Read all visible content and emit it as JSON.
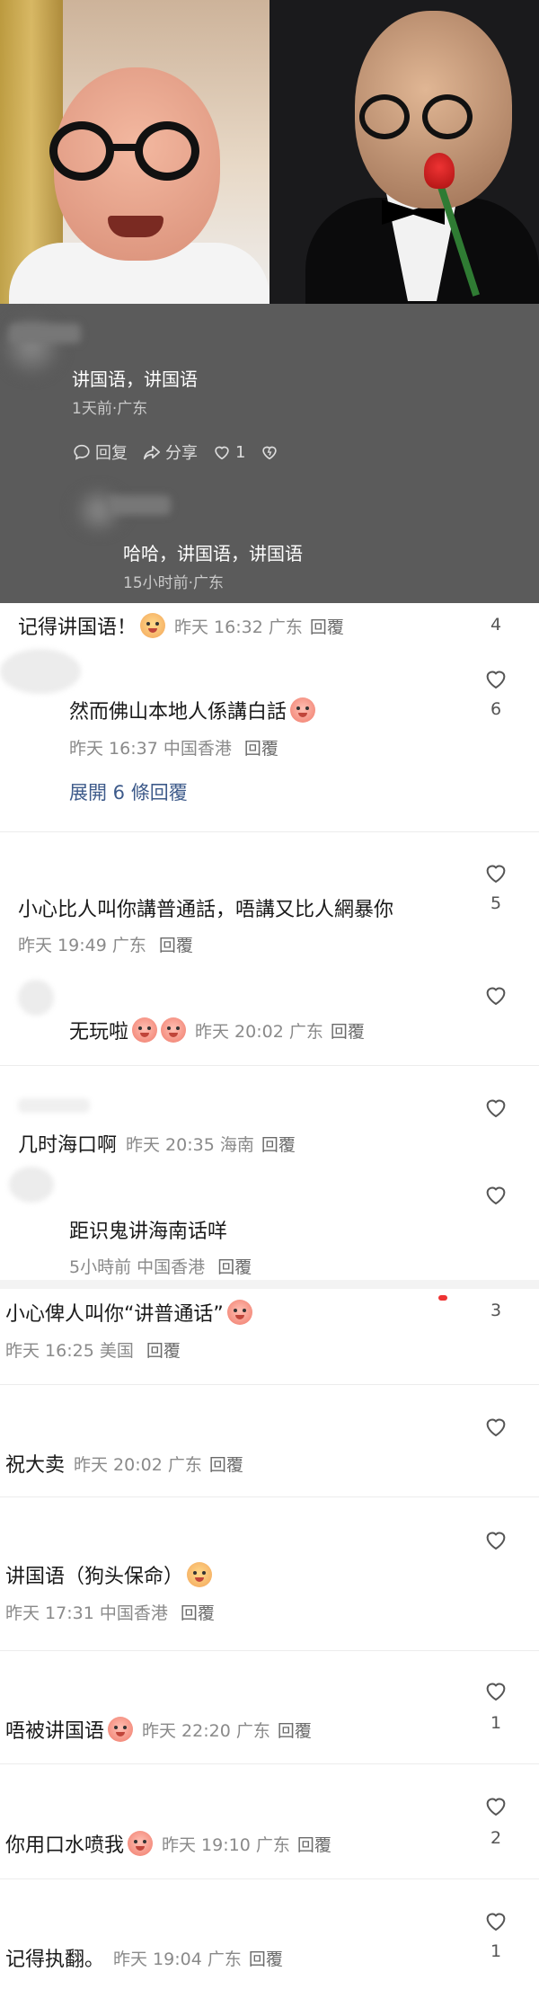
{
  "top_reply": {
    "text": "讲国语，讲国语",
    "meta": "1天前·广东",
    "actions": {
      "reply_label": "回复",
      "share_label": "分享",
      "like_count": "1"
    }
  },
  "nested_reply": {
    "text": "哈哈，讲国语，讲国语",
    "meta": "15小时前·广东"
  },
  "comments": [
    {
      "text": "记得讲国语！",
      "time": "昨天 16:32 广东",
      "reply": "回覆",
      "likes": "4"
    },
    {
      "text": "然而佛山本地人係講白話",
      "time": "昨天 16:37 中国香港",
      "reply": "回覆",
      "likes": "6",
      "expand": "展開 6 條回覆"
    },
    {
      "text": "小心比人叫你講普通話，唔講又比人網暴你",
      "time": "昨天 19:49 广东",
      "reply": "回覆",
      "likes": "5"
    },
    {
      "text": "无玩啦",
      "time": "昨天 20:02 广东",
      "reply": "回覆"
    },
    {
      "text": "几时海口啊",
      "time": "昨天 20:35 海南",
      "reply": "回覆"
    },
    {
      "text": "距识鬼讲海南话咩",
      "time": "5小時前 中国香港",
      "reply": "回覆"
    },
    {
      "text": "小心俾人叫你“讲普通话”",
      "time": "昨天 16:25 美国",
      "reply": "回覆",
      "likes": "3"
    },
    {
      "text": "祝大卖",
      "time": "昨天 20:02 广东",
      "reply": "回覆"
    },
    {
      "text": "讲国语（狗头保命）",
      "time": "昨天 17:31 中国香港",
      "reply": "回覆"
    },
    {
      "text": "唔被讲国语",
      "time": "昨天 22:20 广东",
      "reply": "回覆",
      "likes": "1"
    },
    {
      "text": "你用口水喷我",
      "time": "昨天 19:10 广东",
      "reply": "回覆",
      "likes": "2"
    },
    {
      "text": "记得执翻。",
      "time": "昨天 19:04 广东",
      "reply": "回覆",
      "likes": "1"
    }
  ],
  "colors": {
    "panel_bg": "#5b5b5b",
    "link": "#3d5a8a",
    "meta": "#8a8a8a"
  },
  "icons": [
    "reply-icon",
    "share-icon",
    "heart-icon",
    "dislike-heart-icon",
    "emoji-icon"
  ]
}
